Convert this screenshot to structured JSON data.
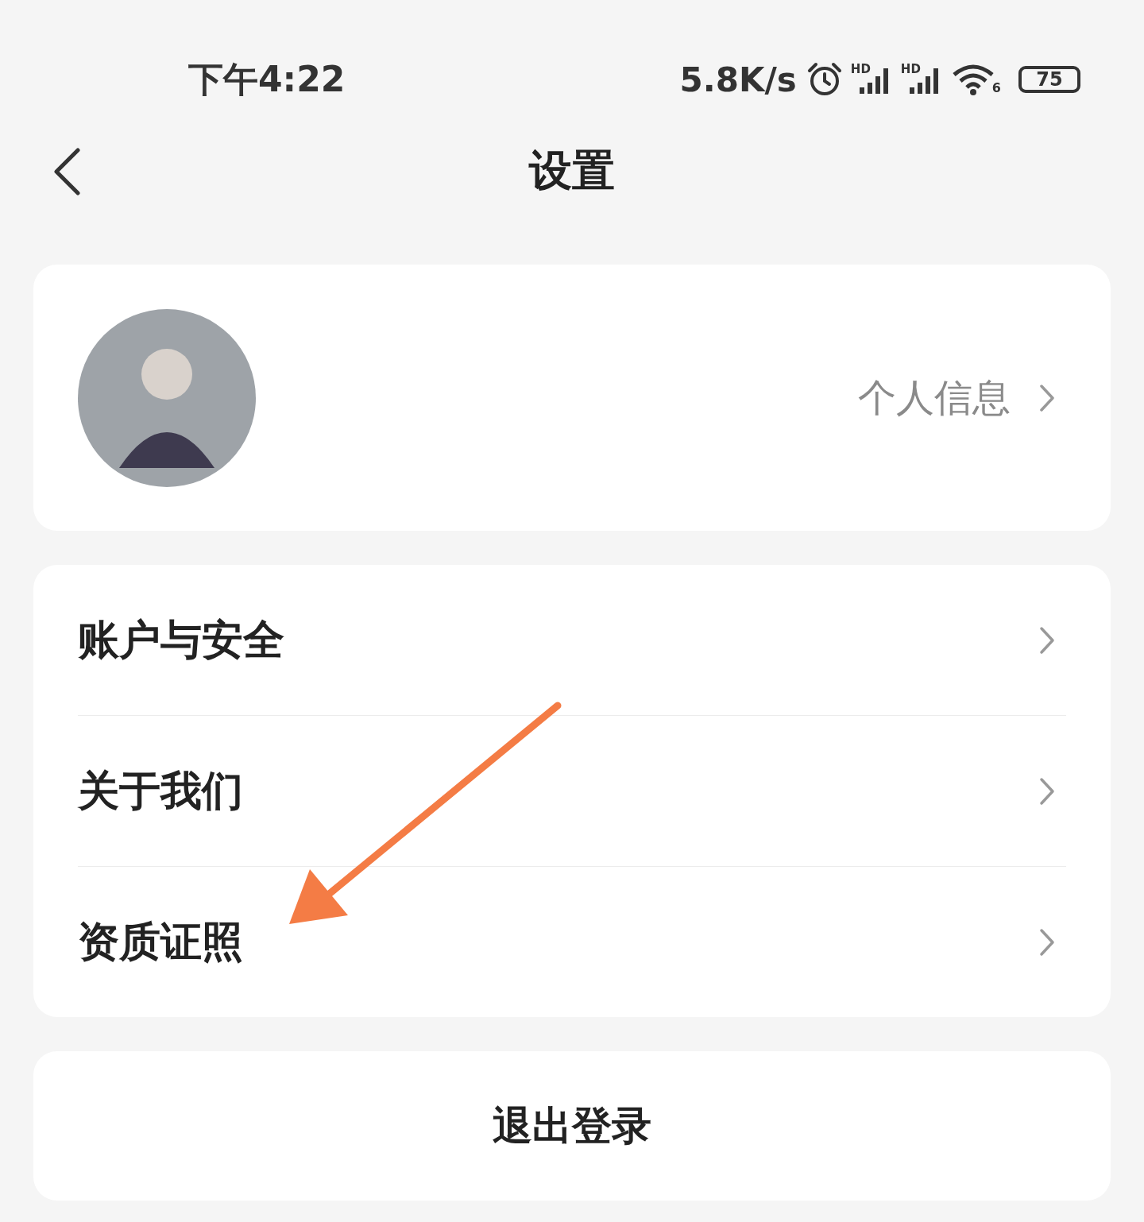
{
  "status_bar": {
    "time": "下午4:22",
    "net_speed": "5.8K/s",
    "signals": [
      {
        "label": "HD"
      },
      {
        "label": "HD"
      }
    ],
    "wifi": {
      "label": "6"
    },
    "battery": {
      "reading": "75"
    }
  },
  "header": {
    "title": "设置"
  },
  "profile": {
    "link": "个人信息"
  },
  "menu": [
    {
      "label": "账户与安全"
    },
    {
      "label": "关于我们"
    },
    {
      "label": "资质证照"
    }
  ],
  "logout": {
    "label": "退出登录"
  }
}
